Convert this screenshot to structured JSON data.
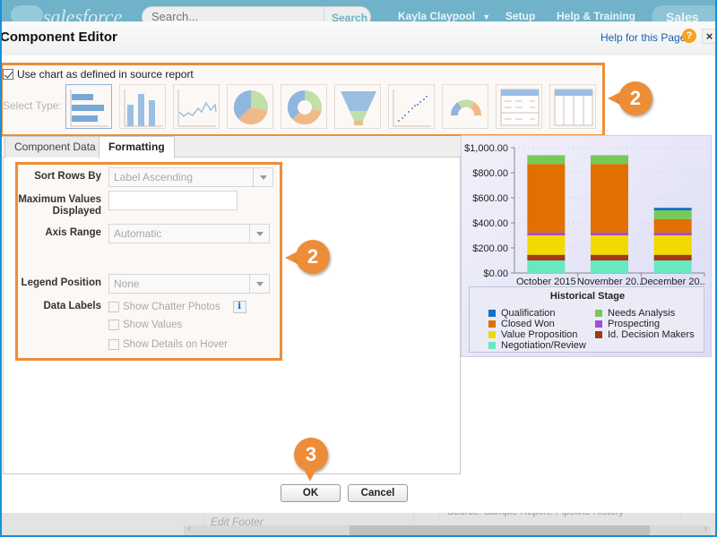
{
  "background_app": {
    "brand": "salesforce",
    "search_placeholder": "Search...",
    "search_button": "Search",
    "user_menu": "Kayla Claypool",
    "nav": [
      "Setup",
      "Help & Training"
    ],
    "app_switcher": "Sales",
    "footer_cell": "Edit Footer",
    "source_cell": "Source: Sample Report: Pipeline History"
  },
  "dialog": {
    "title": "Component Editor",
    "help_link": "Help for this Page",
    "help_icon": "?",
    "close_icon": "×"
  },
  "type_selection": {
    "use_chart_checkbox_label": "Use chart as defined in source report",
    "use_chart_checked": true,
    "select_type_label": "Select Type:",
    "types": [
      {
        "name": "horizontal-bar",
        "selected": true
      },
      {
        "name": "vertical-bar",
        "selected": false
      },
      {
        "name": "line",
        "selected": false
      },
      {
        "name": "pie",
        "selected": false
      },
      {
        "name": "donut",
        "selected": false
      },
      {
        "name": "funnel",
        "selected": false
      },
      {
        "name": "scatter",
        "selected": false
      },
      {
        "name": "gauge",
        "selected": false
      },
      {
        "name": "table",
        "selected": false
      },
      {
        "name": "metric-table",
        "selected": false
      }
    ]
  },
  "tabs": [
    {
      "label": "Component Data",
      "active": false
    },
    {
      "label": "Formatting",
      "active": true
    }
  ],
  "formatting": {
    "sort_rows_by": {
      "label": "Sort Rows By",
      "value": "Label Ascending"
    },
    "max_values": {
      "label_line1": "Maximum Values",
      "label_line2": "Displayed",
      "value": ""
    },
    "axis_range": {
      "label": "Axis Range",
      "value": "Automatic"
    },
    "legend_position": {
      "label": "Legend Position",
      "value": "None"
    },
    "data_labels": {
      "label": "Data Labels",
      "options": [
        {
          "label": "Show Chatter Photos",
          "checked": false,
          "info": "i"
        },
        {
          "label": "Show Values",
          "checked": false
        },
        {
          "label": "Show Details on Hover",
          "checked": false
        }
      ]
    }
  },
  "callouts": {
    "type_callout": "2",
    "formatting_callout": "2",
    "ok_callout": "3"
  },
  "buttons": {
    "ok": "OK",
    "cancel": "Cancel"
  },
  "colors": {
    "highlight": "#ee8d37",
    "link": "#1b5ea8",
    "header_bg": "#6fb2c9"
  },
  "chart_data": {
    "type": "bar",
    "stacked": true,
    "categories": [
      "October 2015",
      "November 20..",
      "December 20.."
    ],
    "series": [
      {
        "name": "Negotiation/Review",
        "color": "#66e8c0",
        "values": [
          100,
          100,
          100
        ]
      },
      {
        "name": "Id. Decision Makers",
        "color": "#a33b12",
        "values": [
          45,
          45,
          45
        ]
      },
      {
        "name": "Value Proposition",
        "color": "#f2d900",
        "values": [
          155,
          155,
          155
        ]
      },
      {
        "name": "Prospecting",
        "color": "#a64ad8",
        "values": [
          22,
          22,
          22
        ]
      },
      {
        "name": "Closed Won",
        "color": "#e07000",
        "values": [
          548,
          548,
          108
        ]
      },
      {
        "name": "Needs Analysis",
        "color": "#77c957",
        "values": [
          70,
          70,
          70
        ]
      },
      {
        "name": "Qualification",
        "color": "#1570c8",
        "values": [
          0,
          0,
          20
        ]
      }
    ],
    "yticks": [
      "$0.00",
      "$200.00",
      "$400.00",
      "$600.00",
      "$800.00",
      "$1,000.00"
    ],
    "ylim": [
      0,
      1000
    ],
    "grid": true,
    "legend_title": "Historical Stage",
    "legend_order": [
      "Qualification",
      "Needs Analysis",
      "Closed Won",
      "Prospecting",
      "Value Proposition",
      "Id. Decision Makers",
      "Negotiation/Review"
    ],
    "legend_placement": "bottom",
    "xlabel": "",
    "ylabel": ""
  }
}
